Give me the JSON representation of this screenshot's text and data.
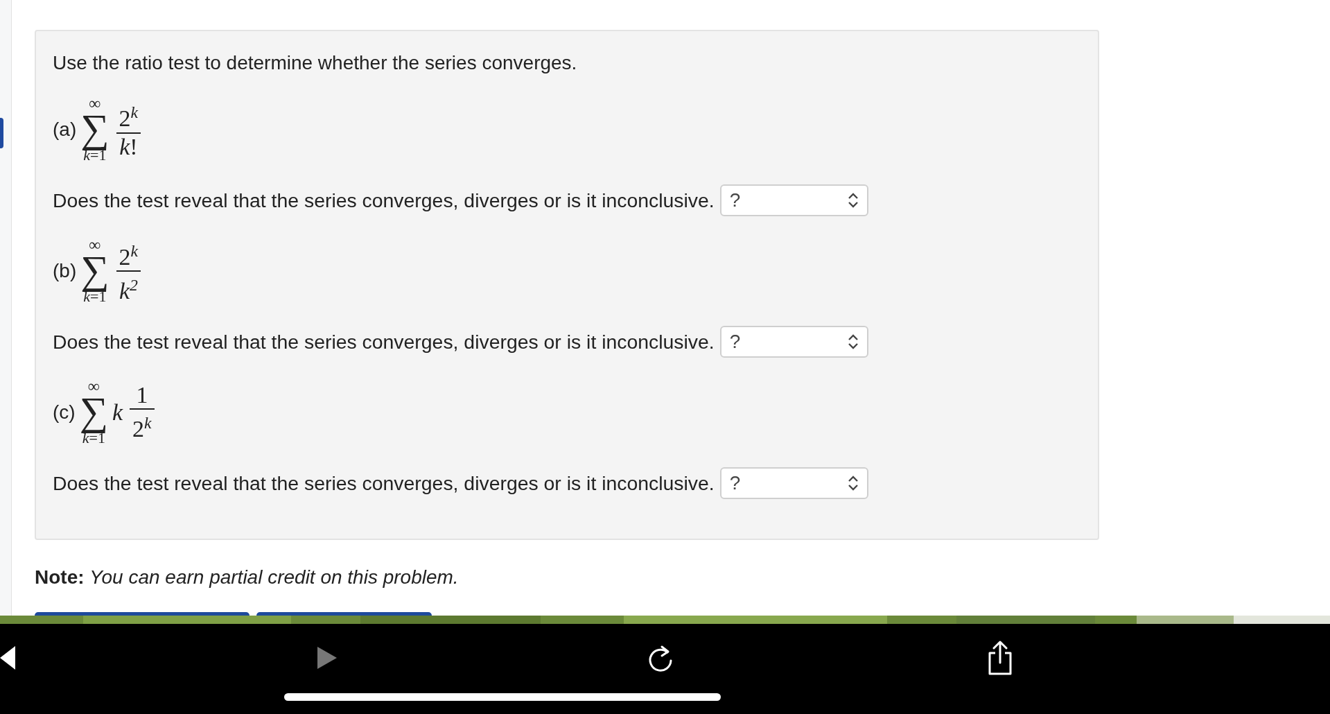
{
  "problem": {
    "intro": "Use the ratio test to determine whether the series converges.",
    "parts": [
      {
        "label": "(a)",
        "upper": "∞",
        "sigma": "∑",
        "lower": "*k*=1",
        "numerator": "2$^{k}$",
        "denominator": "*k*!",
        "question": "Does the test reveal that the series converges, diverges or is it inconclusive.",
        "answer": {
          "value": "?"
        }
      },
      {
        "label": "(b)",
        "upper": "∞",
        "sigma": "∑",
        "lower": "*k*=1",
        "numerator": "2$^{k}$",
        "denominator": "*k*$^{2}$",
        "question": "Does the test reveal that the series converges, diverges or is it inconclusive.",
        "answer": {
          "value": "?"
        }
      },
      {
        "label": "(c)",
        "upper": "∞",
        "sigma": "∑",
        "lower": "*k*=1",
        "coefficient": "*k*",
        "numerator": "1",
        "denominator": "2$^{k}$",
        "question": "Does the test reveal that the series converges, diverges or is it inconclusive.",
        "answer": {
          "value": "?"
        }
      }
    ]
  },
  "note": {
    "label": "Note:",
    "text": "You can earn partial credit on this problem."
  },
  "toolbar": {
    "buttons": [
      {
        "kind": "back",
        "disabled": false
      },
      {
        "kind": "forward",
        "disabled": true
      },
      {
        "kind": "reload",
        "disabled": false
      },
      {
        "kind": "share",
        "disabled": false
      }
    ]
  }
}
